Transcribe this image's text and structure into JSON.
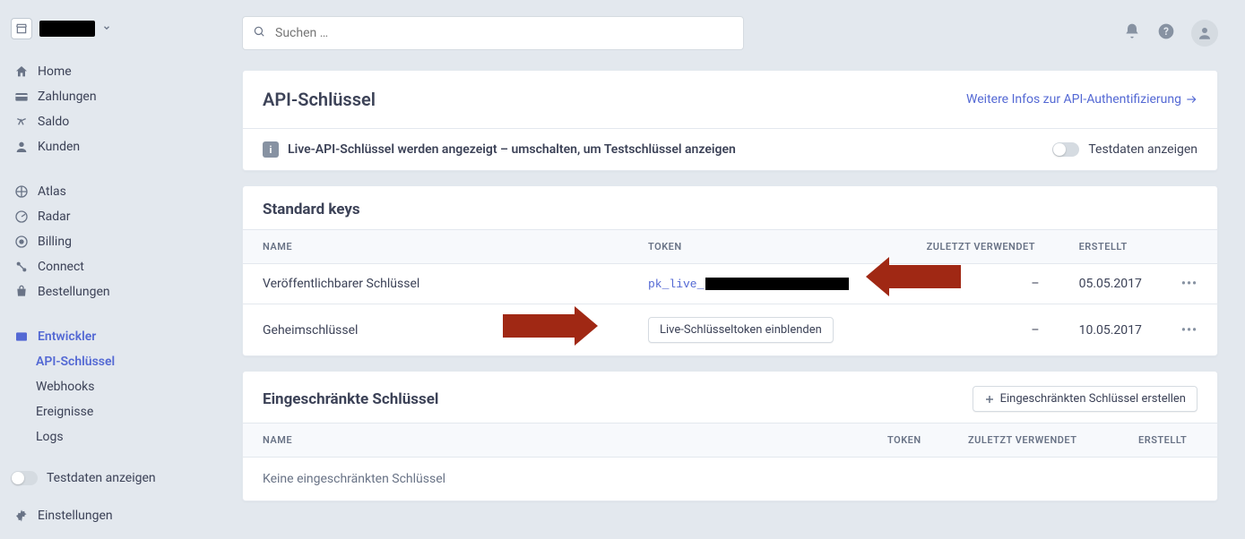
{
  "search": {
    "placeholder": "Suchen …"
  },
  "nav": {
    "home": "Home",
    "payments": "Zahlungen",
    "balance": "Saldo",
    "customers": "Kunden",
    "atlas": "Atlas",
    "radar": "Radar",
    "billing": "Billing",
    "connect": "Connect",
    "orders": "Bestellungen",
    "developers": "Entwickler",
    "api_keys": "API-Schlüssel",
    "webhooks": "Webhooks",
    "events": "Ereignisse",
    "logs": "Logs",
    "test_toggle": "Testdaten anzeigen",
    "settings": "Einstellungen"
  },
  "page": {
    "title": "API-Schlüssel",
    "more_link": "Weitere Infos zur API-Authentifizierung",
    "banner_text": "Live-API-Schlüssel werden angezeigt – umschalten, um Testschlüssel anzeigen",
    "banner_toggle": "Testdaten anzeigen"
  },
  "standard": {
    "title": "Standard keys",
    "columns": {
      "name": "NAME",
      "token": "TOKEN",
      "last": "ZULETZT VERWENDET",
      "created": "ERSTELLT"
    },
    "rows": [
      {
        "name": "Veröffentlichbarer Schlüssel",
        "token_prefix": "pk_live_",
        "last": "–",
        "created": "05.05.2017"
      },
      {
        "name": "Geheimschlüssel",
        "reveal_label": "Live-Schlüsseltoken einblenden",
        "last": "–",
        "created": "10.05.2017"
      }
    ]
  },
  "restricted": {
    "title": "Eingeschränkte Schlüssel",
    "create_label": "Eingeschränkten Schlüssel erstellen",
    "columns": {
      "name": "NAME",
      "token": "TOKEN",
      "last": "ZULETZT VERWENDET",
      "created": "ERSTELLT"
    },
    "empty": "Keine eingeschränkten Schlüssel"
  }
}
